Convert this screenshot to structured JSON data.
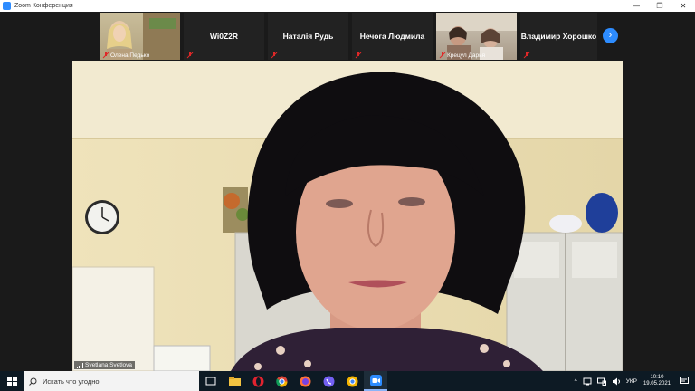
{
  "window": {
    "title": "Zoom Конференция",
    "minimize": "—",
    "maximize": "❐",
    "close": "✕"
  },
  "participants": [
    {
      "name": "Олена Педько",
      "video": true,
      "muted": true
    },
    {
      "name": "Wi0Z2R",
      "video": false,
      "muted": true
    },
    {
      "name": "Наталія Рудь",
      "video": false,
      "muted": true
    },
    {
      "name": "Нечога Людмила",
      "video": false,
      "muted": true
    },
    {
      "name": "Крецул Дарья",
      "video": true,
      "muted": true
    },
    {
      "name": "Владимир Хорошко",
      "video": false,
      "muted": true
    }
  ],
  "next_page_icon": "chevron-right-icon",
  "speaker": {
    "name": "Svetlana Svetlova"
  },
  "taskbar": {
    "search_placeholder": "Искать что угодно",
    "pinned": [
      "task-view-icon",
      "file-explorer-icon",
      "opera-icon",
      "chrome-icon",
      "firefox-icon",
      "viber-icon",
      "chrome-icon",
      "zoom-icon"
    ],
    "tray_language": "УКР",
    "time": "10:10",
    "date": "19.05.2021"
  },
  "colors": {
    "accent": "#2d8cff",
    "taskbar": "#0d1a24",
    "mute": "#e02828"
  }
}
